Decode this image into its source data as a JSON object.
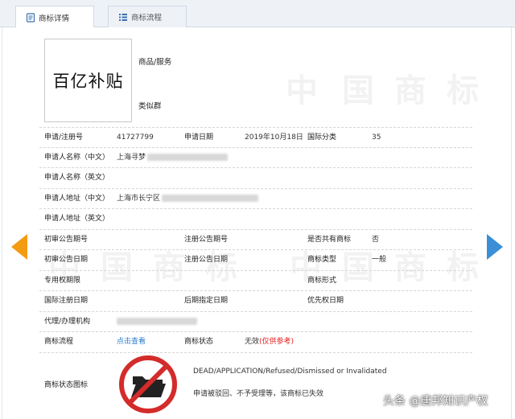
{
  "tabs": [
    {
      "label": "商标详情",
      "active": true,
      "icon": "document-icon"
    },
    {
      "label": "商标流程",
      "active": false,
      "icon": "list-icon"
    }
  ],
  "watermark": [
    "中",
    "国",
    "商",
    "标"
  ],
  "logo_text": "百亿补贴",
  "goods_label": "商品/服务",
  "similar_label": "类似群",
  "fields": {
    "reg_no_label": "申请/注册号",
    "reg_no": "41727799",
    "app_date_label": "申请日期",
    "app_date": "2019年10月18日",
    "intl_class_label": "国际分类",
    "intl_class": "35",
    "applicant_cn_label": "申请人名称（中文）",
    "applicant_cn": "上海寻梦",
    "applicant_en_label": "申请人名称（英文）",
    "address_cn_label": "申请人地址（中文）",
    "address_cn": "上海市长宁区",
    "address_en_label": "申请人地址（英文）",
    "prelim_pub_no_label": "初审公告期号",
    "reg_pub_no_label": "注册公告期号",
    "shared_label": "是否共有商标",
    "shared": "否",
    "prelim_pub_date_label": "初审公告日期",
    "reg_pub_date_label": "注册公告日期",
    "tm_type_label": "商标类型",
    "tm_type": "一般",
    "exclusive_period_label": "专用权期限",
    "tm_form_label": "商标形式",
    "intl_reg_date_label": "国际注册日期",
    "later_designation_label": "后期指定日期",
    "priority_date_label": "优先权日期",
    "agent_label": "代理/办理机构",
    "process_label": "商标流程",
    "process_link": "点击查看",
    "status_label": "商标状态",
    "status_value": "无效",
    "status_note": "(仅供参考)",
    "status_icon_label": "商标状态图标"
  },
  "status_en": "DEAD/APPLICATION/Refused/Dismissed or Invalidated",
  "status_cn": "申请被驳回、不予受理等，该商标已失效",
  "source_tag": "头条 @唐邦知识产权",
  "colors": {
    "link": "#2a7bc7",
    "red": "#e02020",
    "arrow_left": "#f39c12",
    "arrow_right": "#3b8fd6"
  }
}
